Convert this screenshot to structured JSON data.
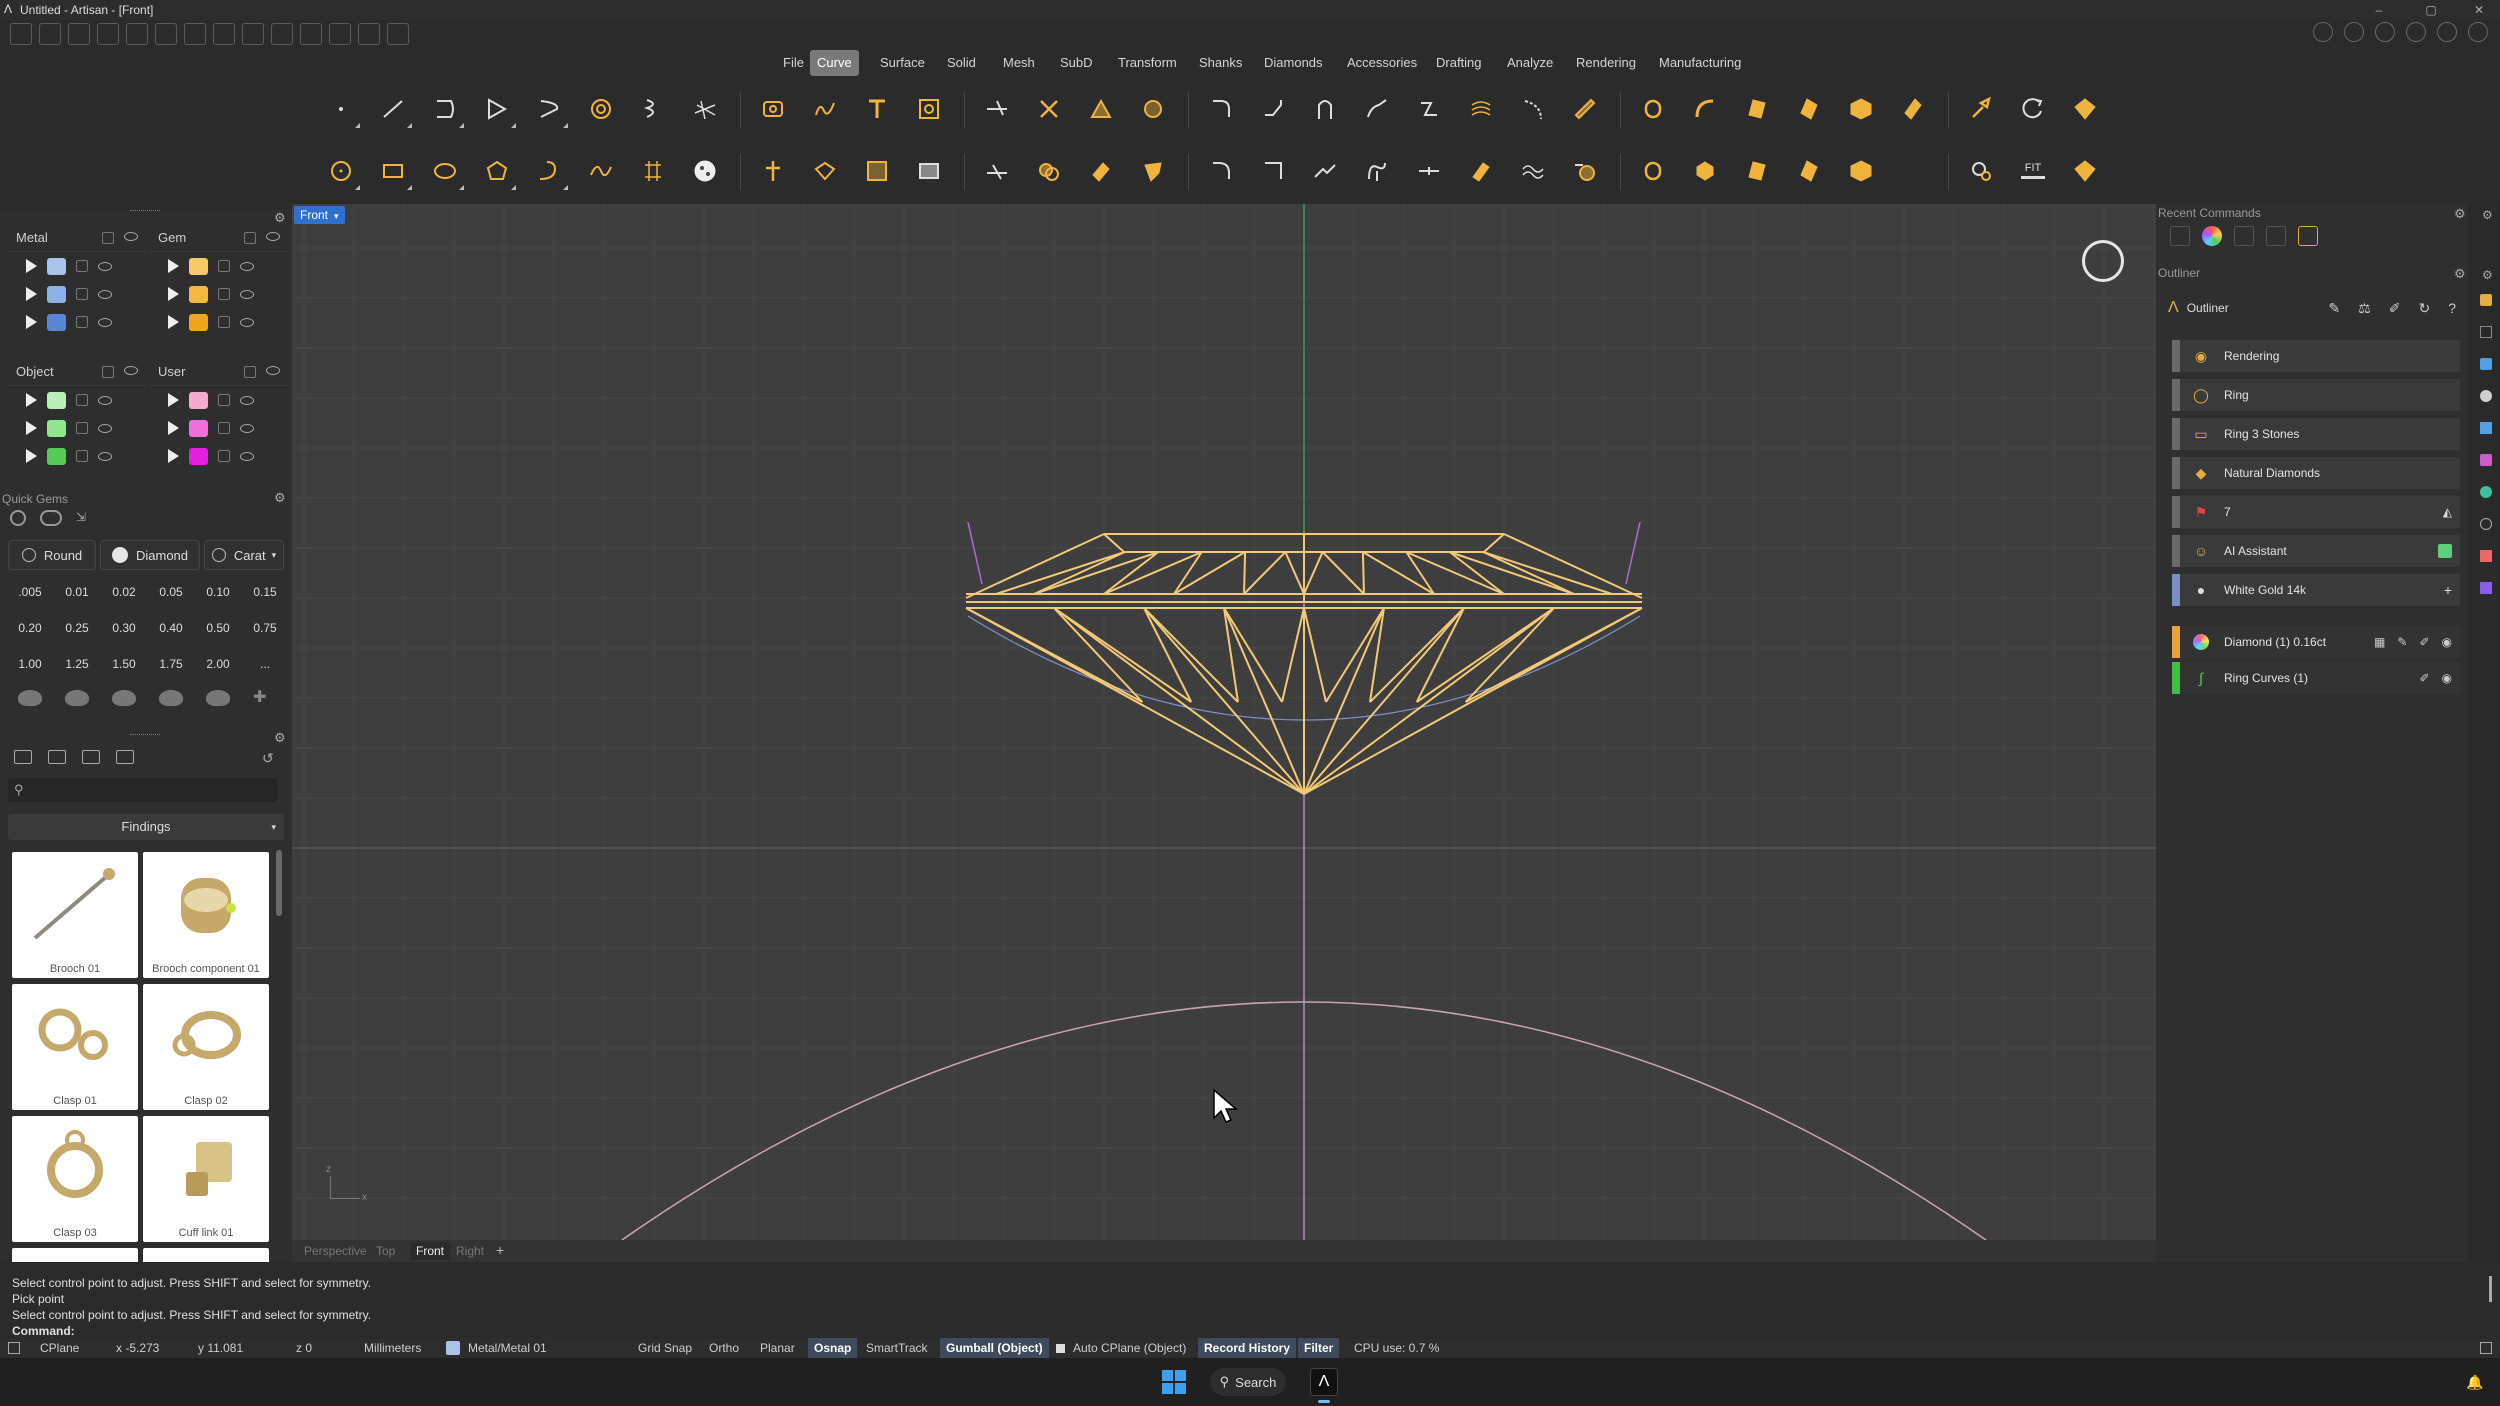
{
  "window": {
    "title": "Untitled - Artisan - [Front]"
  },
  "menu": {
    "items": [
      "File",
      "Curve",
      "Surface",
      "Solid",
      "Mesh",
      "SubD",
      "Transform",
      "Shanks",
      "Diamonds",
      "Accessories",
      "Drafting",
      "Analyze",
      "Rendering",
      "Manufacturing"
    ],
    "active_index": 1,
    "active_color": "#7a7a7a"
  },
  "toolbar": {
    "fit_label": "FIT",
    "accent_color": "#f0b33d"
  },
  "layers": {
    "metal": {
      "label": "Metal",
      "colors": [
        "#a9c3ea",
        "#8fb2e6",
        "#5b86d6"
      ]
    },
    "gem": {
      "label": "Gem",
      "colors": [
        "#f6c868",
        "#f3b83f",
        "#eea61c"
      ]
    },
    "object": {
      "label": "Object",
      "colors": [
        "#b8f0b8",
        "#8fe68f",
        "#55cc55"
      ]
    },
    "user": {
      "label": "User",
      "colors": [
        "#f4a9cf",
        "#ee70d8",
        "#e21fdc"
      ]
    }
  },
  "quick_gems": {
    "title": "Quick Gems",
    "shape": "Round",
    "cut": "Diamond",
    "unit": "Carat",
    "carat_values": [
      ".005",
      "0.01",
      "0.02",
      "0.05",
      "0.10",
      "0.15",
      "0.20",
      "0.25",
      "0.30",
      "0.40",
      "0.50",
      "0.75",
      "1.00",
      "1.25",
      "1.50",
      "1.75",
      "2.00",
      "..."
    ]
  },
  "findings": {
    "category": "Findings",
    "search_placeholder": "",
    "items": [
      "Brooch 01",
      "Brooch component 01",
      "Clasp 01",
      "Clasp 02",
      "Clasp 03",
      "Cuff link 01"
    ]
  },
  "viewport": {
    "name": "Front",
    "tabs": [
      "Perspective",
      "Top",
      "Front",
      "Right"
    ],
    "active_tab": "Front",
    "add_tab": "+",
    "gem_color": "#f3c978",
    "axis_labels": {
      "z": "z",
      "x": "x"
    }
  },
  "right_panel": {
    "recent_commands_title": "Recent Commands",
    "outliner_title": "Outliner",
    "outliner_header": "Outliner",
    "rows": [
      {
        "label": "Rendering",
        "icon": "palette-icon",
        "bar": "#6a6a6a"
      },
      {
        "label": "Ring",
        "icon": "ring-icon",
        "bar": "#6a6a6a"
      },
      {
        "label": "Ring 3 Stones",
        "icon": "ring-stones-icon",
        "bar": "#6a6a6a"
      },
      {
        "label": "Natural Diamonds",
        "icon": "diamond-icon",
        "bar": "#6a6a6a"
      },
      {
        "label": "7",
        "icon": "flag-icon",
        "bar": "#6a6a6a"
      },
      {
        "label": "AI Assistant",
        "icon": "ai-icon",
        "bar": "#6a6a6a"
      },
      {
        "label": "White Gold 14k",
        "icon": "material-icon",
        "bar": "#7a8fc8"
      }
    ],
    "objects": [
      {
        "label": "Diamond (1) 0.16ct",
        "bar": "#e9a23b"
      },
      {
        "label": "Ring Curves (1)",
        "bar": "#3fbf3f"
      }
    ]
  },
  "command_history": [
    "Select control point to adjust. Press SHIFT and select for symmetry.",
    "Pick point",
    "Select control point to adjust. Press SHIFT and select for symmetry."
  ],
  "command_prompt": "Command:",
  "status": {
    "cplane": "CPlane",
    "x": "x -5.273",
    "y": "y 11.081",
    "z": "z 0",
    "units": "Millimeters",
    "layer": "Metal/Metal 01",
    "grid_snap": "Grid Snap",
    "ortho": "Ortho",
    "planar": "Planar",
    "osnap": "Osnap",
    "smarttrack": "SmartTrack",
    "gumball": "Gumball (Object)",
    "auto_cplane": "Auto CPlane (Object)",
    "record_history": "Record History",
    "filter": "Filter",
    "cpu": "CPU use: 0.7 %"
  },
  "taskbar": {
    "search_label": "Search"
  }
}
